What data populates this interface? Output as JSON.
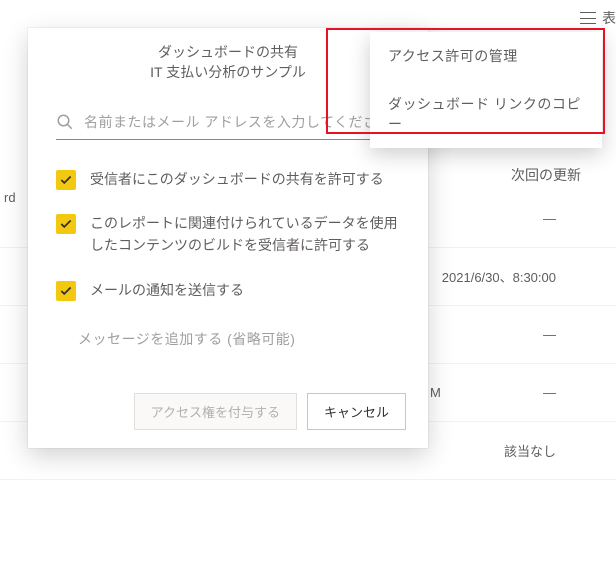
{
  "header": {
    "hamburger_label": "menu",
    "right_text": "表"
  },
  "background": {
    "column_header": "次回の更新",
    "rows": [
      {
        "value": "—",
        "left_fragment": ""
      },
      {
        "value": "2021/6/30、8:30:00",
        "left_fragment": ""
      },
      {
        "value": "—",
        "left_fragment": "rd"
      },
      {
        "value": "—",
        "left_fragment": "",
        "mid_fragment": "M"
      },
      {
        "value": "該当なし",
        "left_fragment": ""
      }
    ]
  },
  "dialog": {
    "title_line1": "ダッシュボードの共有",
    "title_line2": "IT 支払い分析のサンプル",
    "search_placeholder": "名前またはメール アドレスを入力してください",
    "options": [
      {
        "label": "受信者にこのダッシュボードの共有を許可する",
        "checked": true
      },
      {
        "label": "このレポートに関連付けられているデータを使用したコンテンツのビルドを受信者に許可する",
        "checked": true
      },
      {
        "label": "メールの通知を送信する",
        "checked": true
      }
    ],
    "message_placeholder": "メッセージを追加する (省略可能)",
    "grant_button": "アクセス権を付与する",
    "cancel_button": "キャンセル"
  },
  "context_menu": {
    "items": [
      "アクセス許可の管理",
      "ダッシュボード リンクのコピー"
    ]
  }
}
